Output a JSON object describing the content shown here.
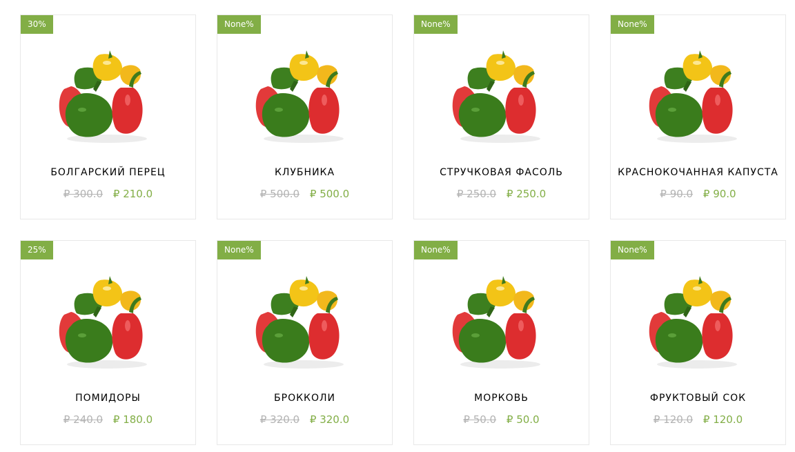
{
  "products": [
    {
      "discount": "30%",
      "name": "БОЛГАРСКИЙ ПЕРЕЦ",
      "old_price": "₽ 300.0",
      "new_price": "₽ 210.0"
    },
    {
      "discount": "None%",
      "name": "КЛУБНИКА",
      "old_price": "₽ 500.0",
      "new_price": "₽ 500.0"
    },
    {
      "discount": "None%",
      "name": "СТРУЧКОВАЯ ФАСОЛЬ",
      "old_price": "₽ 250.0",
      "new_price": "₽ 250.0"
    },
    {
      "discount": "None%",
      "name": "КРАСНОКОЧАННАЯ КАПУСТА",
      "old_price": "₽ 90.0",
      "new_price": "₽ 90.0"
    },
    {
      "discount": "25%",
      "name": "ПОМИДОРЫ",
      "old_price": "₽ 240.0",
      "new_price": "₽ 180.0"
    },
    {
      "discount": "None%",
      "name": "БРОККОЛИ",
      "old_price": "₽ 320.0",
      "new_price": "₽ 320.0"
    },
    {
      "discount": "None%",
      "name": "МОРКОВЬ",
      "old_price": "₽ 50.0",
      "new_price": "₽ 50.0"
    },
    {
      "discount": "None%",
      "name": "ФРУКТОВЫЙ СОК",
      "old_price": "₽ 120.0",
      "new_price": "₽ 120.0"
    }
  ],
  "colors": {
    "accent": "#82ae46",
    "old_price": "#b3b3b3",
    "border": "#e8e8e8"
  },
  "image_icon": "bell-peppers-image"
}
